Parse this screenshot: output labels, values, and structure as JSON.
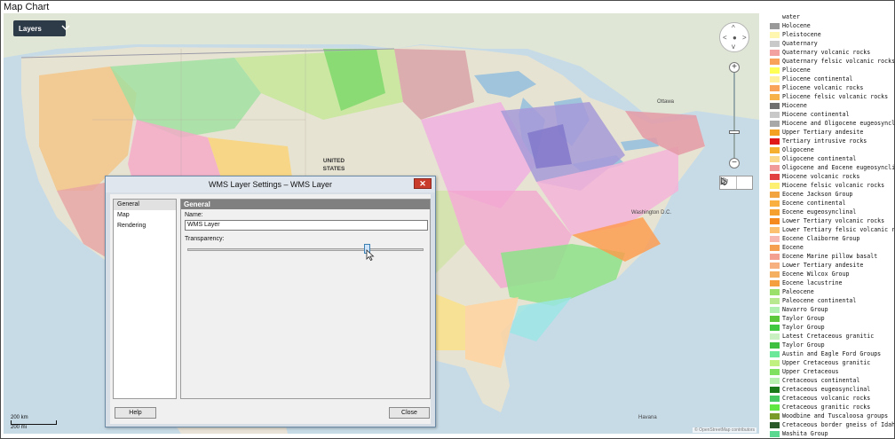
{
  "window": {
    "title": "Map Chart"
  },
  "map": {
    "layers_button": "Layers",
    "labels": {
      "united_states": "UNITED STATES",
      "ottawa": "Ottawa",
      "washington": "Washington D.C.",
      "havana": "Havana"
    },
    "scale": {
      "km": "200 km",
      "mi": "200 mi"
    },
    "attribution": "© OpenStreetMap contributors",
    "zoom_in": "+",
    "zoom_out": "−"
  },
  "dialog": {
    "title": "WMS Layer Settings – WMS Layer",
    "close_glyph": "✕",
    "nav_items": [
      "General",
      "Map",
      "Rendering"
    ],
    "selected_nav": "General",
    "panel_header": "General",
    "name_label": "Name:",
    "name_value": "WMS Layer",
    "transparency_label": "Transparency:",
    "transparency_value": 0.76,
    "help_button": "Help",
    "close_button": "Close"
  },
  "legend": [
    {
      "label": "water",
      "color": "#ffffff"
    },
    {
      "label": "Holocene",
      "color": "#9a9a9a"
    },
    {
      "label": "Pleistocene",
      "color": "#fff6b0"
    },
    {
      "label": "Quaternary",
      "color": "#c9c9c9"
    },
    {
      "label": "Quaternary volcanic rocks",
      "color": "#f3a0a0"
    },
    {
      "label": "Quaternary felsic volcanic rocks",
      "color": "#f9a35a"
    },
    {
      "label": "Pliocene",
      "color": "#ffff55"
    },
    {
      "label": "Pliocene continental",
      "color": "#fff0a0"
    },
    {
      "label": "Pliocene volcanic rocks",
      "color": "#f9a35a"
    },
    {
      "label": "Pliocene felsic volcanic rocks",
      "color": "#f7b24a"
    },
    {
      "label": "Miocene",
      "color": "#707070"
    },
    {
      "label": "Miocene continental",
      "color": "#c8c8c8"
    },
    {
      "label": "Miocene and Oligocene eugeosyncli",
      "color": "#a8a8a8"
    },
    {
      "label": "Upper Tertiary andesite",
      "color": "#f4a020"
    },
    {
      "label": "Tertiary intrusive rocks",
      "color": "#e01818"
    },
    {
      "label": "Oligocene",
      "color": "#f6b030"
    },
    {
      "label": "Oligocene continental",
      "color": "#fbd98a"
    },
    {
      "label": "Oligocene and Eocene eugeosynclin",
      "color": "#f09a9a"
    },
    {
      "label": "Miocene volcanic rocks",
      "color": "#e24040"
    },
    {
      "label": "Miocene felsic volcanic rocks",
      "color": "#fdf070"
    },
    {
      "label": "Eocene Jackson Group",
      "color": "#f2a440"
    },
    {
      "label": "Eocene continental",
      "color": "#f9b040"
    },
    {
      "label": "Eocene eugeosynclinal",
      "color": "#f6a030"
    },
    {
      "label": "Lower Tertiary volcanic rocks",
      "color": "#f48a20"
    },
    {
      "label": "Lower Tertiary felsic volcanic ro",
      "color": "#fbc070"
    },
    {
      "label": "Eocene Claiborne Group",
      "color": "#f6b8b0"
    },
    {
      "label": "Eocene",
      "color": "#f4a050"
    },
    {
      "label": "Eocene Marine pillow basalt",
      "color": "#f4a090"
    },
    {
      "label": "Lower Tertiary andesite",
      "color": "#f7b080"
    },
    {
      "label": "Eocene Wilcox Group",
      "color": "#f4b060"
    },
    {
      "label": "Eocene lacustrine",
      "color": "#f4a040"
    },
    {
      "label": "Paleocene",
      "color": "#9ae06a"
    },
    {
      "label": "Paleocene continental",
      "color": "#b8e890"
    },
    {
      "label": "Navarro Group",
      "color": "#b0f0b0"
    },
    {
      "label": "Taylor Group",
      "color": "#5ac83a"
    },
    {
      "label": "Taylor Group",
      "color": "#40c840"
    },
    {
      "label": "Latest Cretaceous granitic",
      "color": "#c8f0c0"
    },
    {
      "label": "Taylor Group",
      "color": "#40c040"
    },
    {
      "label": "Austin and Eagle Ford Groups",
      "color": "#6ce89a"
    },
    {
      "label": "Upper Cretaceous granitic",
      "color": "#c0f080"
    },
    {
      "label": "Upper Cretaceous",
      "color": "#80e060"
    },
    {
      "label": "Cretaceous continental",
      "color": "#b8f0b0"
    },
    {
      "label": "Cretaceous eugeosynclinal",
      "color": "#1a7a1a"
    },
    {
      "label": "Cretaceous volcanic rocks",
      "color": "#48c860"
    },
    {
      "label": "Cretaceous granitic rocks",
      "color": "#60e840"
    },
    {
      "label": "Woodbine and Tuscaloosa groups",
      "color": "#7a9a2a"
    },
    {
      "label": "Cretaceous border gneiss of Idaho",
      "color": "#2a5a2a"
    },
    {
      "label": "Washita Group",
      "color": "#5ad890"
    }
  ]
}
